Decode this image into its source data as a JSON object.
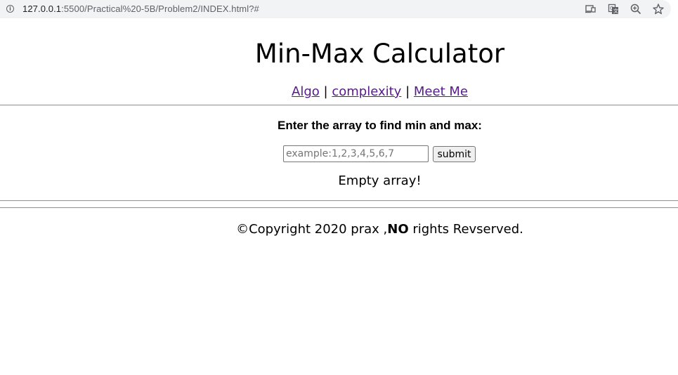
{
  "browser": {
    "url_host": "127.0.0.1",
    "url_path": ":5500/Practical%20-5B/Problem2/INDEX.html?#",
    "info_icon_glyph": "i",
    "icons": [
      "info-icon",
      "cast-icon",
      "translate-icon",
      "zoom-icon",
      "bookmark-star-icon"
    ]
  },
  "page": {
    "title": "Min-Max Calculator",
    "nav": {
      "algo": "Algo",
      "complexity": "complexity",
      "meet_me": "Meet Me",
      "separator": "|"
    },
    "form": {
      "prompt": "Enter the array to find min and max:",
      "input_value": "",
      "input_placeholder": "example:1,2,3,4,5,6,7",
      "submit_label": "submit"
    },
    "result": "Empty array!",
    "footer": {
      "prefix": "©Copyright 2020 prax ,",
      "bold": "NO",
      "suffix": " rights Revserved."
    }
  },
  "colors": {
    "link_visited": "#551a8b",
    "rule": "#9a9a9a",
    "button_bg": "#efefef",
    "addressbar_bg": "#f1f3f4"
  }
}
